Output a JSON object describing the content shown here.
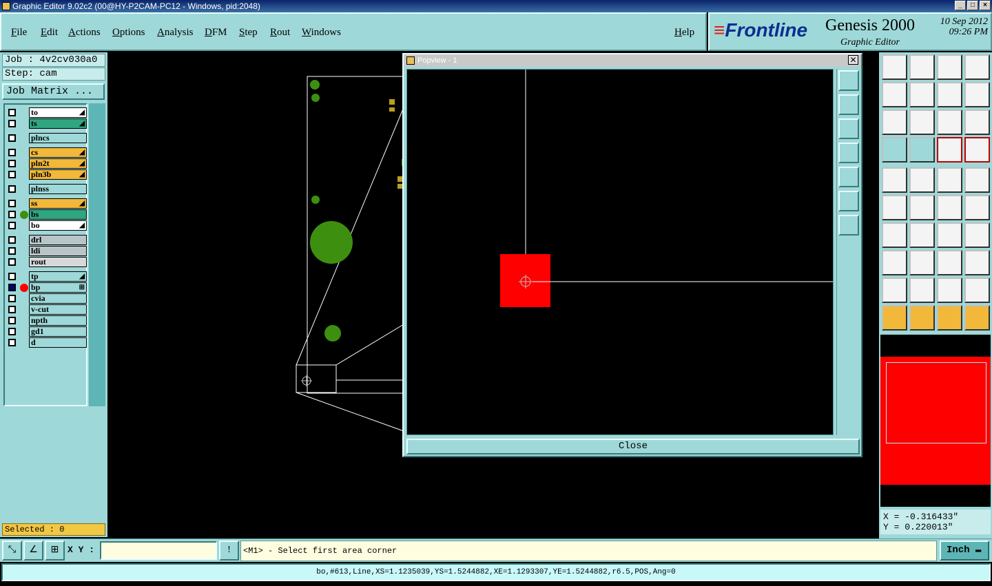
{
  "window": {
    "title": "Graphic Editor 9.02c2 (00@HY-P2CAM-PC12 - Windows, pid:2048)"
  },
  "menu": {
    "items": [
      "File",
      "Edit",
      "Actions",
      "Options",
      "Analysis",
      "DFM",
      "Step",
      "Rout",
      "Windows"
    ],
    "help": "Help"
  },
  "brand": {
    "logo": "Frontline",
    "product": "Genesis 2000",
    "subtitle": "Graphic Editor",
    "date": "10 Sep 2012",
    "time": "09:26 PM"
  },
  "job": {
    "job_label": "Job : 4v2cv030a0",
    "step_label": "Step: cam",
    "matrix_button": "Job Matrix ..."
  },
  "layers": [
    {
      "name": "to",
      "color": "#ffffff",
      "mark": "◢"
    },
    {
      "name": "ts",
      "color": "#2fa67f",
      "mark": "◢"
    },
    {
      "name": "plncs",
      "color": "#9fd8d8",
      "mark": ""
    },
    {
      "name": "cs",
      "color": "#f2b83a",
      "mark": "◢"
    },
    {
      "name": "pln2t",
      "color": "#f2b83a",
      "mark": "◢"
    },
    {
      "name": "pln3b",
      "color": "#f2b83a",
      "mark": "◢"
    },
    {
      "name": "plnss",
      "color": "#9fd8d8",
      "mark": ""
    },
    {
      "name": "ss",
      "color": "#f2b83a",
      "mark": "◢"
    },
    {
      "name": "bs",
      "color": "#2fa67f",
      "mark": ""
    },
    {
      "name": "bo",
      "color": "#ffffff",
      "mark": "◢"
    },
    {
      "name": "drl",
      "color": "#b8c4c8",
      "mark": ""
    },
    {
      "name": "ldi",
      "color": "#b8c4c8",
      "mark": ""
    },
    {
      "name": "rout",
      "color": "#d8d8d8",
      "mark": ""
    },
    {
      "name": "tp",
      "color": "#9fd8d8",
      "mark": "◢"
    },
    {
      "name": "bp",
      "color": "#9fd8d8",
      "mark": "⊞"
    },
    {
      "name": "cvia",
      "color": "#9fd8d8",
      "mark": ""
    },
    {
      "name": "v-cut",
      "color": "#9fd8d8",
      "mark": ""
    },
    {
      "name": "npth",
      "color": "#9fd8d8",
      "mark": ""
    },
    {
      "name": "gd1",
      "color": "#9fd8d8",
      "mark": ""
    },
    {
      "name": "d",
      "color": "#9fd8d8",
      "mark": ""
    }
  ],
  "selected": "Selected : 0",
  "popview": {
    "title": "Popview - 1",
    "close_label": "Close",
    "close_x": "✕"
  },
  "coords": {
    "x": "X = -0.316433\"",
    "y": "Y = 0.220013\""
  },
  "bottom": {
    "xy_label": "X Y :",
    "xy_value": "",
    "warn": "!",
    "prompt": "<M1> - Select first area corner",
    "unit": "Inch"
  },
  "status": "bo,#613,Line,XS=1.1235039,YS=1.5244882,XE=1.1293307,YE=1.5244882,r6.5,POS,Ang=0",
  "colors": {
    "teal": "#9fd8d8",
    "pad_red": "#ff0000",
    "feature_green": "#3d8f10",
    "yellow": "#f2b83a"
  }
}
